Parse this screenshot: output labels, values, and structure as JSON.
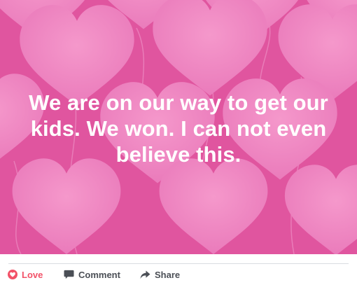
{
  "post": {
    "text": "We are on our way to get our kids. We won. I can not even believe this.",
    "background_color": "#e0559f",
    "heart_color": "#ee86c2"
  },
  "actions": {
    "love_label": "Love",
    "love_color": "#f25268",
    "love_icon": "heart-icon",
    "comment_label": "Comment",
    "comment_icon": "speech-bubble-icon",
    "share_label": "Share",
    "share_icon": "share-arrow-icon"
  }
}
